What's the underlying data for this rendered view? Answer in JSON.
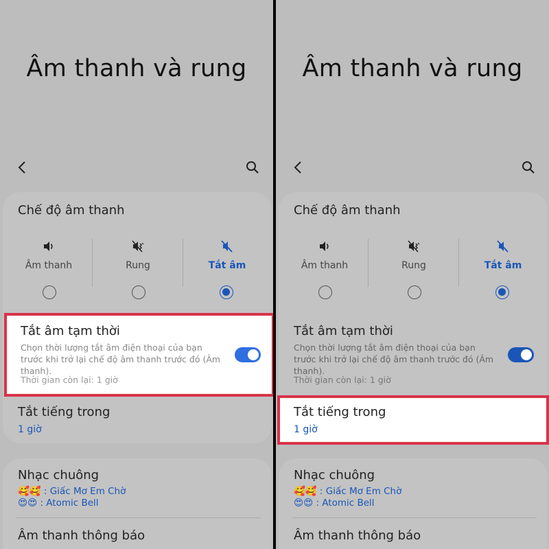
{
  "screens": [
    {
      "title": "Âm thanh và rung",
      "sound_mode": {
        "section_title": "Chế độ âm thanh",
        "modes": [
          {
            "label": "Âm thanh",
            "icon": "speaker-icon",
            "selected": false
          },
          {
            "label": "Rung",
            "icon": "vibrate-icon",
            "selected": false
          },
          {
            "label": "Tắt âm",
            "icon": "mute-icon",
            "selected": true
          }
        ]
      },
      "temporary_mute": {
        "title": "Tắt âm tạm thời",
        "description": "Chọn thời lượng tắt âm điện thoại của bạn trước khi trở lại chế độ âm thanh trước đó (Âm thanh).",
        "remaining": "Thời gian còn lại: 1 giờ",
        "enabled": true,
        "highlighted": true
      },
      "mute_for": {
        "title": "Tắt tiếng trong",
        "value": "1 giờ",
        "highlighted": false
      },
      "ringtone": {
        "title": "Nhạc chuông",
        "entries": [
          {
            "emoji": "🥰🥰",
            "sep": " : ",
            "name": "Giấc Mơ Em Chờ"
          },
          {
            "emoji": "😍😍",
            "sep": " : ",
            "name": "Atomic Bell"
          }
        ]
      },
      "notification_sound": {
        "title": "Âm thanh thông báo"
      }
    },
    {
      "title": "Âm thanh và rung",
      "sound_mode": {
        "section_title": "Chế độ âm thanh",
        "modes": [
          {
            "label": "Âm thanh",
            "icon": "speaker-icon",
            "selected": false
          },
          {
            "label": "Rung",
            "icon": "vibrate-icon",
            "selected": false
          },
          {
            "label": "Tắt âm",
            "icon": "mute-icon",
            "selected": true
          }
        ]
      },
      "temporary_mute": {
        "title": "Tắt âm tạm thời",
        "description": "Chọn thời lượng tắt âm điện thoại của bạn trước khi trở lại chế độ âm thanh trước đó (Âm thanh).",
        "remaining": "Thời gian còn lại: 1 giờ",
        "enabled": true,
        "highlighted": false
      },
      "mute_for": {
        "title": "Tắt tiếng trong",
        "value": "1 giờ",
        "highlighted": true
      },
      "ringtone": {
        "title": "Nhạc chuông",
        "entries": [
          {
            "emoji": "🥰🥰",
            "sep": " : ",
            "name": "Giấc Mơ Em Chờ"
          },
          {
            "emoji": "😍😍",
            "sep": " : ",
            "name": "Atomic Bell"
          }
        ]
      },
      "notification_sound": {
        "title": "Âm thanh thông báo"
      }
    }
  ],
  "colors": {
    "accent": "#1a56b8",
    "highlight_border": "#d8344a",
    "background": "#bdbdbd"
  }
}
